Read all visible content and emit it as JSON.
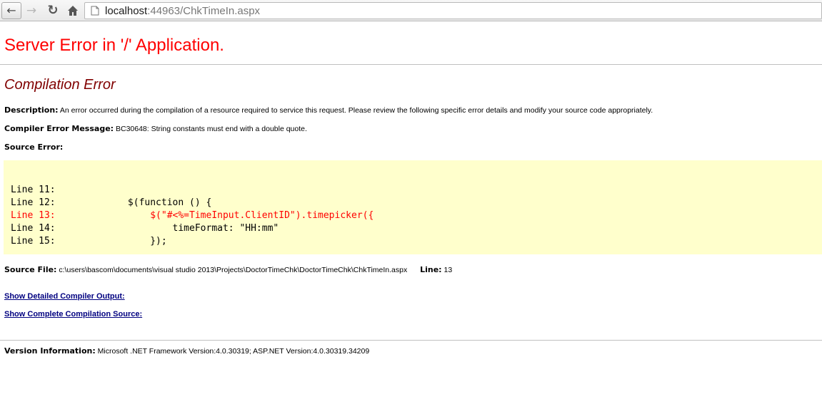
{
  "browser": {
    "url_host": "localhost",
    "url_rest": ":44963/ChkTimeIn.aspx",
    "icons": [
      "back-icon",
      "forward-icon",
      "reload-icon",
      "home-icon",
      "page-icon"
    ]
  },
  "page": {
    "title": "Server Error in '/' Application.",
    "error_heading": "Compilation Error",
    "description_label": "Description:",
    "description_text": "An error occurred during the compilation of a resource required to service this request. Please review the following specific error details and modify your source code appropriately.",
    "compiler_label": "Compiler Error Message:",
    "compiler_text": "BC30648: String constants must end with a double quote.",
    "source_error_label": "Source Error:",
    "code_lines": [
      {
        "num": "Line 11:",
        "code": "",
        "error": false
      },
      {
        "num": "Line 12:",
        "code": "            $(function () {",
        "error": false
      },
      {
        "num": "Line 13:",
        "code": "                $(\"#<%=TimeInput.ClientID\").timepicker({",
        "error": true
      },
      {
        "num": "Line 14:",
        "code": "                    timeFormat: \"HH:mm\"",
        "error": false
      },
      {
        "num": "Line 15:",
        "code": "                });",
        "error": false
      }
    ],
    "source_file_label": "Source File:",
    "source_file_path": "c:\\users\\bascom\\documents\\visual studio 2013\\Projects\\DoctorTimeChk\\DoctorTimeChk\\ChkTimeIn.aspx",
    "line_label": "Line:",
    "line_value": "13",
    "link_detailed": "Show Detailed Compiler Output:",
    "link_complete": "Show Complete Compilation Source:",
    "version_label": "Version Information:",
    "version_text": "Microsoft .NET Framework Version:4.0.30319; ASP.NET Version:4.0.30319.34209"
  },
  "colors": {
    "title": "#ff0000",
    "heading": "#800000",
    "code_background": "#ffffcc",
    "error_line": "#ff0000",
    "link": "#000080"
  }
}
